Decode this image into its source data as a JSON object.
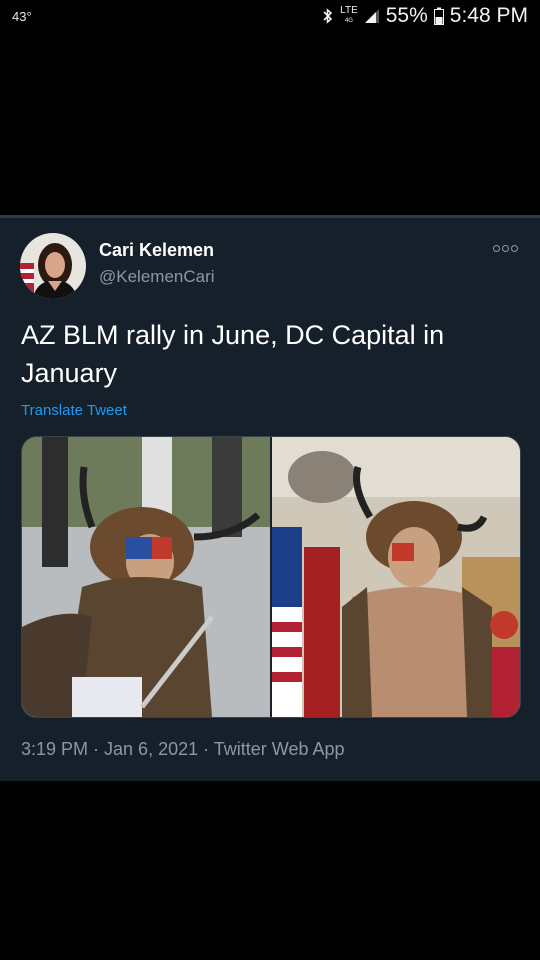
{
  "status_bar": {
    "temperature": "43°",
    "network": "LTE",
    "network_sub": "4G",
    "battery": "55%",
    "time": "5:48 PM"
  },
  "tweet": {
    "display_name": "Cari Kelemen",
    "handle": "@KelemenCari",
    "text": "AZ BLM rally in June, DC Capital in January",
    "translate_label": "Translate Tweet",
    "meta": "3:19 PM · Jan 6, 2021 · Twitter Web App",
    "images": [
      {
        "icon": "rally-photo"
      },
      {
        "icon": "capitol-photo"
      }
    ]
  },
  "colors": {
    "card_bg": "#15202b",
    "muted": "#8899a6",
    "link": "#1d9bf0"
  }
}
